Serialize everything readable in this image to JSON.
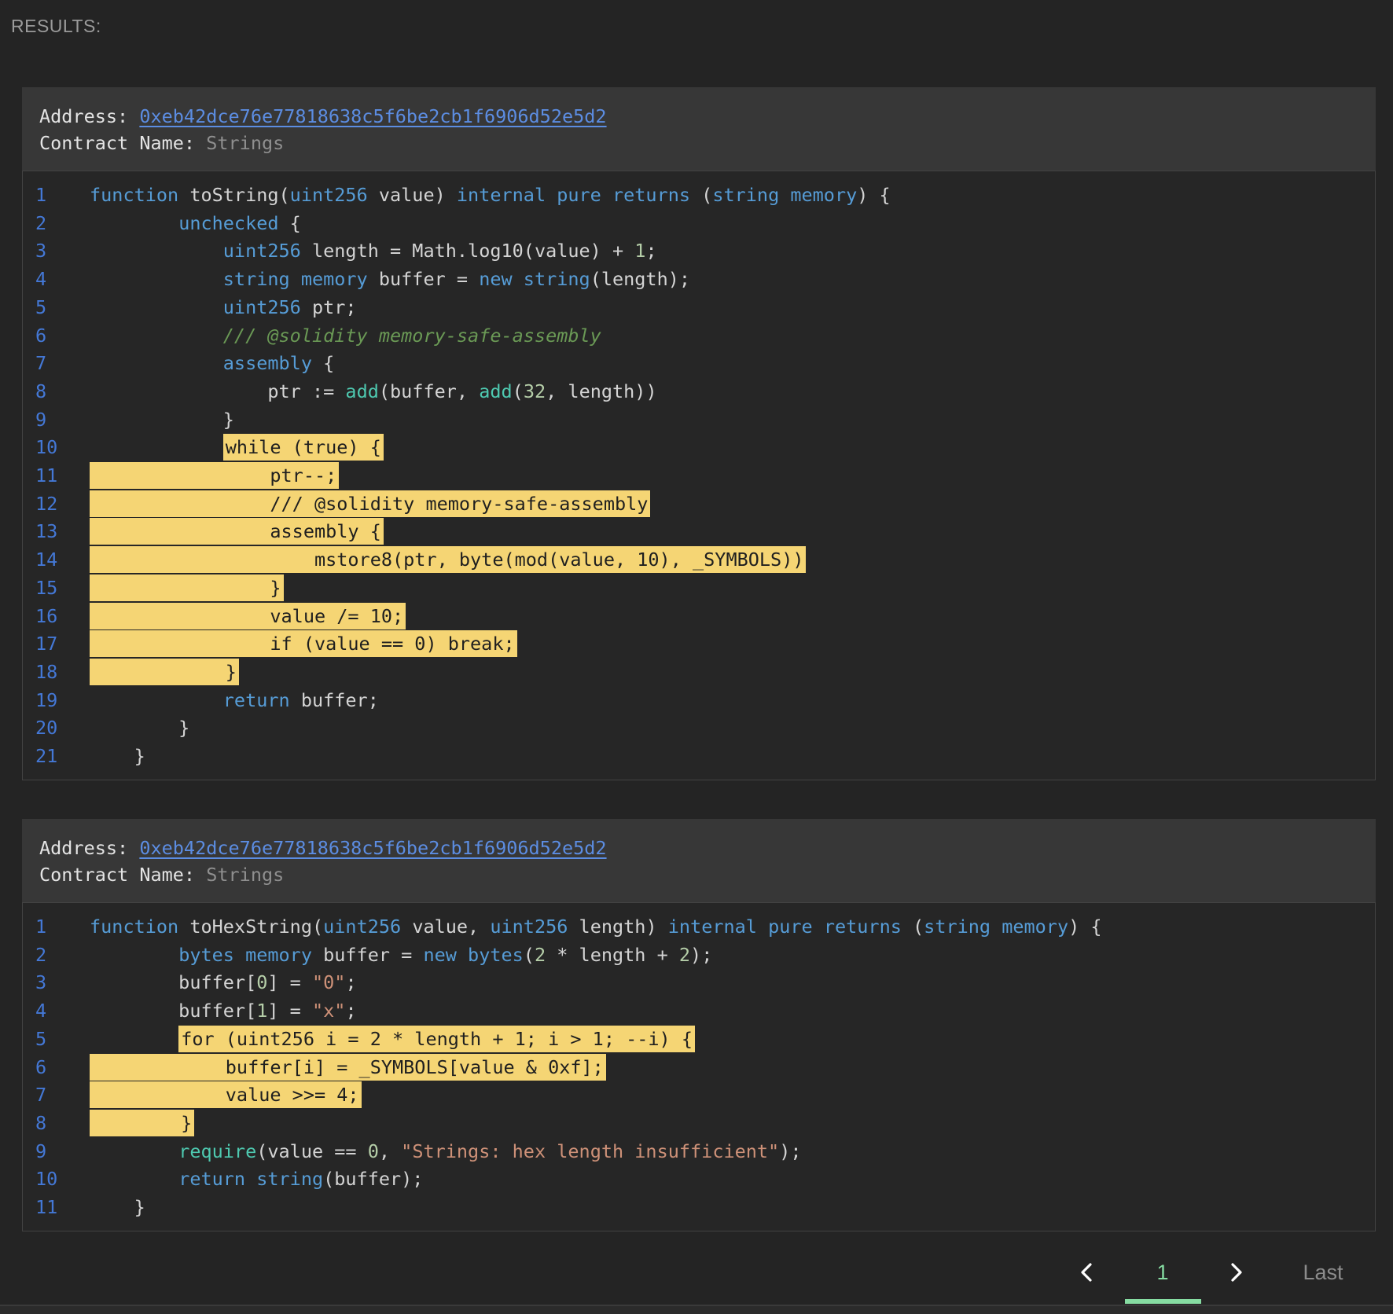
{
  "results_label": "RESULTS:",
  "ui_colors": {
    "page_background": "#242424",
    "card_header_background": "#373737",
    "code_background": "#262626",
    "code_border": "#424242",
    "highlight_yellow": "#f5d574",
    "highlight_text": "#1f1f1f",
    "address_link_blue": "#5c8de2",
    "line_number_blue": "#4478d6",
    "pagination_green": "#86dca2"
  },
  "syntax_colors": {
    "plain": "#d4d4d4",
    "keyword": "#569cd6",
    "number": "#b5cea8",
    "string": "#ce9178",
    "comment": "#6a9955",
    "builtin_call": "#4ec9b0"
  },
  "pagination": {
    "prev_icon": "chevron-left",
    "current_page": "1",
    "next_icon": "chevron-right",
    "last_label": "Last"
  },
  "cards": [
    {
      "address_label": "Address: ",
      "address": "0xeb42dce76e77818638c5f6be2cb1f6906d52e5d2",
      "contract_label": "Contract Name: ",
      "contract_name": "Strings",
      "lines": [
        {
          "n": "1",
          "seg": [
            [
              "k",
              "function"
            ],
            [
              "p",
              " toString("
            ],
            [
              "k",
              "uint256"
            ],
            [
              "p",
              " value) "
            ],
            [
              "k",
              "internal pure returns"
            ],
            [
              "p",
              " ("
            ],
            [
              "k",
              "string memory"
            ],
            [
              "p",
              ") {"
            ]
          ]
        },
        {
          "n": "2",
          "seg": [
            [
              "p",
              "        "
            ],
            [
              "k",
              "unchecked"
            ],
            [
              "p",
              " {"
            ]
          ]
        },
        {
          "n": "3",
          "seg": [
            [
              "p",
              "            "
            ],
            [
              "k",
              "uint256"
            ],
            [
              "p",
              " length = Math.log10(value) + "
            ],
            [
              "n_",
              "1"
            ],
            [
              "p",
              ";"
            ]
          ]
        },
        {
          "n": "4",
          "seg": [
            [
              "p",
              "            "
            ],
            [
              "k",
              "string memory"
            ],
            [
              "p",
              " buffer = "
            ],
            [
              "k",
              "new string"
            ],
            [
              "p",
              "(length);"
            ]
          ]
        },
        {
          "n": "5",
          "seg": [
            [
              "p",
              "            "
            ],
            [
              "k",
              "uint256"
            ],
            [
              "p",
              " ptr;"
            ]
          ]
        },
        {
          "n": "6",
          "seg": [
            [
              "p",
              "            "
            ],
            [
              "c",
              "/// @solidity memory-safe-assembly"
            ]
          ]
        },
        {
          "n": "7",
          "seg": [
            [
              "p",
              "            "
            ],
            [
              "k",
              "assembly"
            ],
            [
              "p",
              " {"
            ]
          ]
        },
        {
          "n": "8",
          "seg": [
            [
              "p",
              "                ptr := "
            ],
            [
              "f",
              "add"
            ],
            [
              "p",
              "(buffer, "
            ],
            [
              "f",
              "add"
            ],
            [
              "p",
              "("
            ],
            [
              "n_",
              "32"
            ],
            [
              "p",
              ", length))"
            ]
          ]
        },
        {
          "n": "9",
          "seg": [
            [
              "p",
              "            }"
            ]
          ]
        },
        {
          "n": "10",
          "seg": [
            [
              "p",
              "            "
            ],
            [
              "h",
              "while (true) {"
            ]
          ]
        },
        {
          "n": "11",
          "seg": [
            [
              "h",
              "                ptr--;"
            ]
          ]
        },
        {
          "n": "12",
          "seg": [
            [
              "h",
              "                /// @solidity memory-safe-assembly"
            ]
          ]
        },
        {
          "n": "13",
          "seg": [
            [
              "h",
              "                assembly {"
            ]
          ]
        },
        {
          "n": "14",
          "seg": [
            [
              "h",
              "                    mstore8(ptr, byte(mod(value, 10), _SYMBOLS))"
            ]
          ]
        },
        {
          "n": "15",
          "seg": [
            [
              "h",
              "                }"
            ]
          ]
        },
        {
          "n": "16",
          "seg": [
            [
              "h",
              "                value /= 10;"
            ]
          ]
        },
        {
          "n": "17",
          "seg": [
            [
              "h",
              "                if (value == 0) break;"
            ]
          ]
        },
        {
          "n": "18",
          "seg": [
            [
              "h",
              "            }"
            ]
          ]
        },
        {
          "n": "19",
          "seg": [
            [
              "p",
              "            "
            ],
            [
              "k",
              "return"
            ],
            [
              "p",
              " buffer;"
            ]
          ]
        },
        {
          "n": "20",
          "seg": [
            [
              "p",
              "        }"
            ]
          ]
        },
        {
          "n": "21",
          "seg": [
            [
              "p",
              "    }"
            ]
          ]
        }
      ]
    },
    {
      "address_label": "Address: ",
      "address": "0xeb42dce76e77818638c5f6be2cb1f6906d52e5d2",
      "contract_label": "Contract Name: ",
      "contract_name": "Strings",
      "lines": [
        {
          "n": "1",
          "seg": [
            [
              "k",
              "function"
            ],
            [
              "p",
              " toHexString("
            ],
            [
              "k",
              "uint256"
            ],
            [
              "p",
              " value, "
            ],
            [
              "k",
              "uint256"
            ],
            [
              "p",
              " length) "
            ],
            [
              "k",
              "internal pure returns"
            ],
            [
              "p",
              " ("
            ],
            [
              "k",
              "string memory"
            ],
            [
              "p",
              ") {"
            ]
          ]
        },
        {
          "n": "2",
          "seg": [
            [
              "p",
              "        "
            ],
            [
              "k",
              "bytes memory"
            ],
            [
              "p",
              " buffer = "
            ],
            [
              "k",
              "new bytes"
            ],
            [
              "p",
              "("
            ],
            [
              "n_",
              "2"
            ],
            [
              "p",
              " * length + "
            ],
            [
              "n_",
              "2"
            ],
            [
              "p",
              ");"
            ]
          ]
        },
        {
          "n": "3",
          "seg": [
            [
              "p",
              "        buffer["
            ],
            [
              "n_",
              "0"
            ],
            [
              "p",
              "] = "
            ],
            [
              "s",
              "\"0\""
            ],
            [
              "p",
              ";"
            ]
          ]
        },
        {
          "n": "4",
          "seg": [
            [
              "p",
              "        buffer["
            ],
            [
              "n_",
              "1"
            ],
            [
              "p",
              "] = "
            ],
            [
              "s",
              "\"x\""
            ],
            [
              "p",
              ";"
            ]
          ]
        },
        {
          "n": "5",
          "seg": [
            [
              "p",
              "        "
            ],
            [
              "h",
              "for (uint256 i = 2 * length + 1; i > 1; --i) {"
            ]
          ]
        },
        {
          "n": "6",
          "seg": [
            [
              "h",
              "            buffer[i] = _SYMBOLS[value & 0xf];"
            ]
          ]
        },
        {
          "n": "7",
          "seg": [
            [
              "h",
              "            value >>= 4;"
            ]
          ]
        },
        {
          "n": "8",
          "seg": [
            [
              "h",
              "        }"
            ]
          ]
        },
        {
          "n": "9",
          "seg": [
            [
              "p",
              "        "
            ],
            [
              "f",
              "require"
            ],
            [
              "p",
              "(value == "
            ],
            [
              "n_",
              "0"
            ],
            [
              "p",
              ", "
            ],
            [
              "s",
              "\"Strings: hex length insufficient\""
            ],
            [
              "p",
              ");"
            ]
          ]
        },
        {
          "n": "10",
          "seg": [
            [
              "p",
              "        "
            ],
            [
              "k",
              "return string"
            ],
            [
              "p",
              "(buffer);"
            ]
          ]
        },
        {
          "n": "11",
          "seg": [
            [
              "p",
              "    }"
            ]
          ]
        }
      ]
    }
  ]
}
